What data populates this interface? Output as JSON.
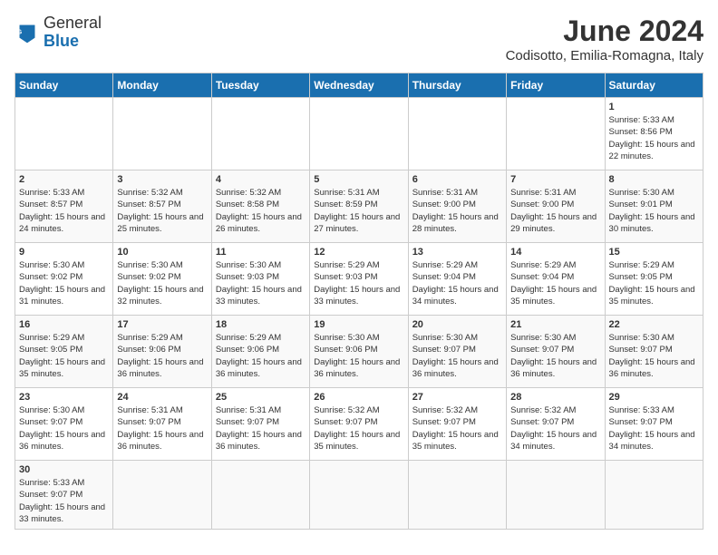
{
  "header": {
    "logo_line1": "General",
    "logo_line2": "Blue",
    "month": "June 2024",
    "location": "Codisotto, Emilia-Romagna, Italy"
  },
  "days_of_week": [
    "Sunday",
    "Monday",
    "Tuesday",
    "Wednesday",
    "Thursday",
    "Friday",
    "Saturday"
  ],
  "weeks": [
    {
      "days": [
        {
          "num": "",
          "empty": true
        },
        {
          "num": "",
          "empty": true
        },
        {
          "num": "",
          "empty": true
        },
        {
          "num": "",
          "empty": true
        },
        {
          "num": "",
          "empty": true
        },
        {
          "num": "",
          "empty": true
        },
        {
          "num": "1",
          "sunrise": "5:33 AM",
          "sunset": "8:56 PM",
          "daylight": "15 hours and 22 minutes."
        }
      ]
    },
    {
      "days": [
        {
          "num": "2",
          "sunrise": "5:33 AM",
          "sunset": "8:57 PM",
          "daylight": "15 hours and 24 minutes."
        },
        {
          "num": "3",
          "sunrise": "5:32 AM",
          "sunset": "8:57 PM",
          "daylight": "15 hours and 25 minutes."
        },
        {
          "num": "4",
          "sunrise": "5:32 AM",
          "sunset": "8:58 PM",
          "daylight": "15 hours and 26 minutes."
        },
        {
          "num": "5",
          "sunrise": "5:31 AM",
          "sunset": "8:59 PM",
          "daylight": "15 hours and 27 minutes."
        },
        {
          "num": "6",
          "sunrise": "5:31 AM",
          "sunset": "9:00 PM",
          "daylight": "15 hours and 28 minutes."
        },
        {
          "num": "7",
          "sunrise": "5:31 AM",
          "sunset": "9:00 PM",
          "daylight": "15 hours and 29 minutes."
        },
        {
          "num": "8",
          "sunrise": "5:30 AM",
          "sunset": "9:01 PM",
          "daylight": "15 hours and 30 minutes."
        }
      ]
    },
    {
      "days": [
        {
          "num": "9",
          "sunrise": "5:30 AM",
          "sunset": "9:02 PM",
          "daylight": "15 hours and 31 minutes."
        },
        {
          "num": "10",
          "sunrise": "5:30 AM",
          "sunset": "9:02 PM",
          "daylight": "15 hours and 32 minutes."
        },
        {
          "num": "11",
          "sunrise": "5:30 AM",
          "sunset": "9:03 PM",
          "daylight": "15 hours and 33 minutes."
        },
        {
          "num": "12",
          "sunrise": "5:29 AM",
          "sunset": "9:03 PM",
          "daylight": "15 hours and 33 minutes."
        },
        {
          "num": "13",
          "sunrise": "5:29 AM",
          "sunset": "9:04 PM",
          "daylight": "15 hours and 34 minutes."
        },
        {
          "num": "14",
          "sunrise": "5:29 AM",
          "sunset": "9:04 PM",
          "daylight": "15 hours and 35 minutes."
        },
        {
          "num": "15",
          "sunrise": "5:29 AM",
          "sunset": "9:05 PM",
          "daylight": "15 hours and 35 minutes."
        }
      ]
    },
    {
      "days": [
        {
          "num": "16",
          "sunrise": "5:29 AM",
          "sunset": "9:05 PM",
          "daylight": "15 hours and 35 minutes."
        },
        {
          "num": "17",
          "sunrise": "5:29 AM",
          "sunset": "9:06 PM",
          "daylight": "15 hours and 36 minutes."
        },
        {
          "num": "18",
          "sunrise": "5:29 AM",
          "sunset": "9:06 PM",
          "daylight": "15 hours and 36 minutes."
        },
        {
          "num": "19",
          "sunrise": "5:30 AM",
          "sunset": "9:06 PM",
          "daylight": "15 hours and 36 minutes."
        },
        {
          "num": "20",
          "sunrise": "5:30 AM",
          "sunset": "9:07 PM",
          "daylight": "15 hours and 36 minutes."
        },
        {
          "num": "21",
          "sunrise": "5:30 AM",
          "sunset": "9:07 PM",
          "daylight": "15 hours and 36 minutes."
        },
        {
          "num": "22",
          "sunrise": "5:30 AM",
          "sunset": "9:07 PM",
          "daylight": "15 hours and 36 minutes."
        }
      ]
    },
    {
      "days": [
        {
          "num": "23",
          "sunrise": "5:30 AM",
          "sunset": "9:07 PM",
          "daylight": "15 hours and 36 minutes."
        },
        {
          "num": "24",
          "sunrise": "5:31 AM",
          "sunset": "9:07 PM",
          "daylight": "15 hours and 36 minutes."
        },
        {
          "num": "25",
          "sunrise": "5:31 AM",
          "sunset": "9:07 PM",
          "daylight": "15 hours and 36 minutes."
        },
        {
          "num": "26",
          "sunrise": "5:32 AM",
          "sunset": "9:07 PM",
          "daylight": "15 hours and 35 minutes."
        },
        {
          "num": "27",
          "sunrise": "5:32 AM",
          "sunset": "9:07 PM",
          "daylight": "15 hours and 35 minutes."
        },
        {
          "num": "28",
          "sunrise": "5:32 AM",
          "sunset": "9:07 PM",
          "daylight": "15 hours and 34 minutes."
        },
        {
          "num": "29",
          "sunrise": "5:33 AM",
          "sunset": "9:07 PM",
          "daylight": "15 hours and 34 minutes."
        }
      ]
    },
    {
      "days": [
        {
          "num": "30",
          "sunrise": "5:33 AM",
          "sunset": "9:07 PM",
          "daylight": "15 hours and 33 minutes."
        },
        {
          "num": "",
          "empty": true
        },
        {
          "num": "",
          "empty": true
        },
        {
          "num": "",
          "empty": true
        },
        {
          "num": "",
          "empty": true
        },
        {
          "num": "",
          "empty": true
        },
        {
          "num": "",
          "empty": true
        }
      ]
    }
  ]
}
